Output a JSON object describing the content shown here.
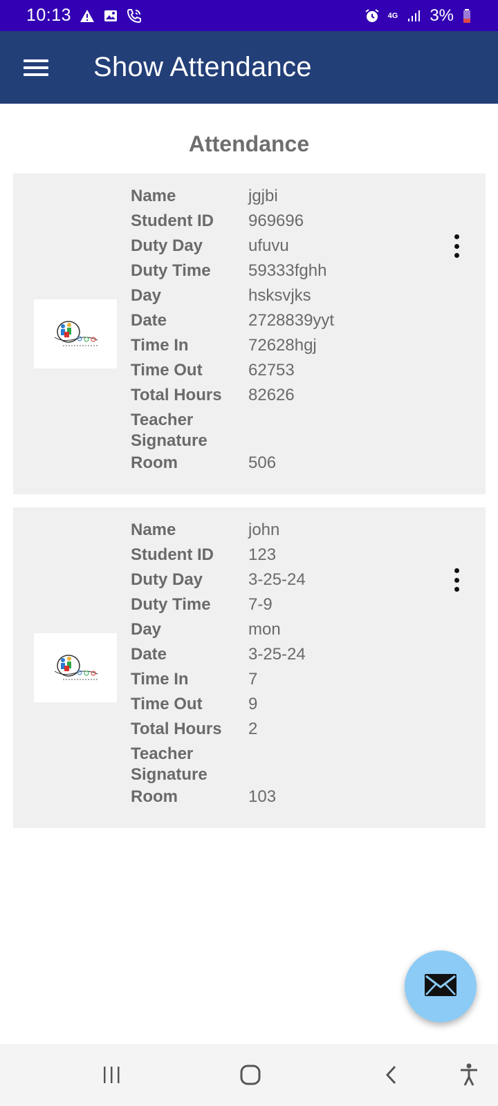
{
  "status_bar": {
    "time": "10:13",
    "network": "4G",
    "battery": "3%",
    "icons": [
      "warning-icon",
      "image-icon",
      "call-icon",
      "alarm-icon",
      "signal-icon",
      "battery-icon"
    ]
  },
  "app_bar": {
    "title": "Show Attendance",
    "menu_icon": "menu-icon"
  },
  "section_title": "Attendance",
  "records": [
    {
      "fields": [
        {
          "label": "Name",
          "value": "jgjbi"
        },
        {
          "label": "Student ID",
          "value": "969696"
        },
        {
          "label": "Duty Day",
          "value": "ufuvu"
        },
        {
          "label": "Duty Time",
          "value": "59333fghh"
        },
        {
          "label": "Day",
          "value": "hsksvjks"
        },
        {
          "label": "Date",
          "value": "2728839yyt"
        },
        {
          "label": "Time In",
          "value": "72628hgj"
        },
        {
          "label": "Time Out",
          "value": "62753"
        },
        {
          "label": "Total Hours",
          "value": "82626"
        },
        {
          "label": "Teacher Signature",
          "value": ""
        },
        {
          "label": "Room",
          "value": "506"
        }
      ]
    },
    {
      "fields": [
        {
          "label": "Name",
          "value": "john"
        },
        {
          "label": "Student ID",
          "value": "123"
        },
        {
          "label": "Duty Day",
          "value": "3-25-24"
        },
        {
          "label": "Duty Time",
          "value": "7-9"
        },
        {
          "label": "Day",
          "value": "mon"
        },
        {
          "label": "Date",
          "value": "3-25-24"
        },
        {
          "label": "Time In",
          "value": "7"
        },
        {
          "label": "Time Out",
          "value": "9"
        },
        {
          "label": "Total Hours",
          "value": "2"
        },
        {
          "label": "Teacher Signature",
          "value": ""
        },
        {
          "label": "Room",
          "value": "103"
        }
      ]
    }
  ],
  "fab": {
    "icon": "mail-icon"
  },
  "colors": {
    "status_bar": "#3300b3",
    "app_bar": "#233f78",
    "card_bg": "#f0f0f0",
    "fab": "#8ccbf6",
    "text_gray": "#6a6a6a"
  }
}
